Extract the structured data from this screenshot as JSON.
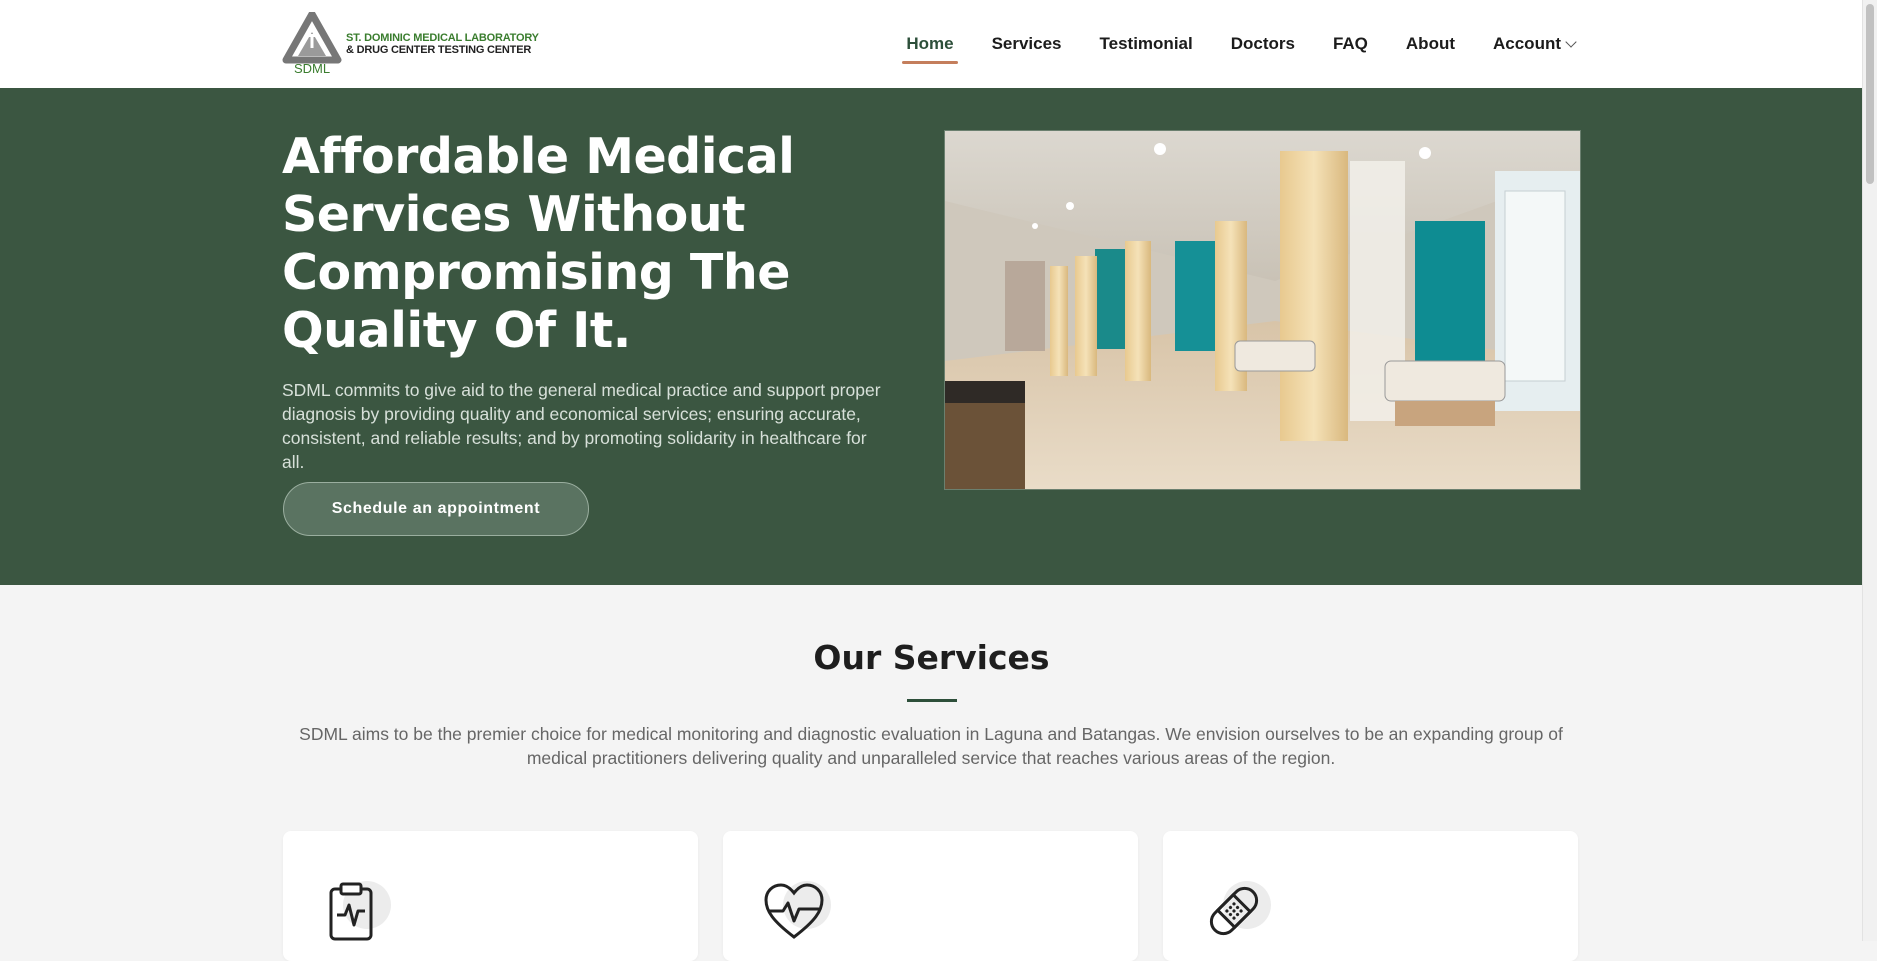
{
  "brand": {
    "mark": "SDML",
    "line1": "ST. DOMINIC MEDICAL LABORATORY",
    "line2": "& DRUG CENTER TESTING CENTER",
    "mark_color": "#3a7d2e"
  },
  "nav": {
    "items": [
      "Home",
      "Services",
      "Testimonial",
      "Doctors",
      "FAQ",
      "About",
      "Account"
    ],
    "active": "Home",
    "account_icon": "chevron-down-icon"
  },
  "hero": {
    "title": "Affordable Medical Services Without Compromising The Quality Of It.",
    "description": "SDML commits to give aid to the general medical practice and support proper diagnosis by providing quality and economical services; ensuring accurate, consistent, and reliable results; and by promoting solidarity in healthcare for all.",
    "cta_label": "Schedule an appointment",
    "image": "hospital-ward-photo",
    "background": "#3b5641"
  },
  "services": {
    "title": "Our Services",
    "description": "SDML aims to be the premier choice for medical monitoring and diagnostic evaluation in Laguna and Batangas. We envision ourselves to be an expanding group of medical practitioners delivering quality and unparalleled service that reaches various areas of the region.",
    "cards": [
      {
        "icon": "clipboard-pulse-icon"
      },
      {
        "icon": "heart-pulse-icon"
      },
      {
        "icon": "bandage-icon"
      }
    ]
  },
  "colors": {
    "accent": "#2d4f3a",
    "nav_underline": "#c47e5c"
  }
}
